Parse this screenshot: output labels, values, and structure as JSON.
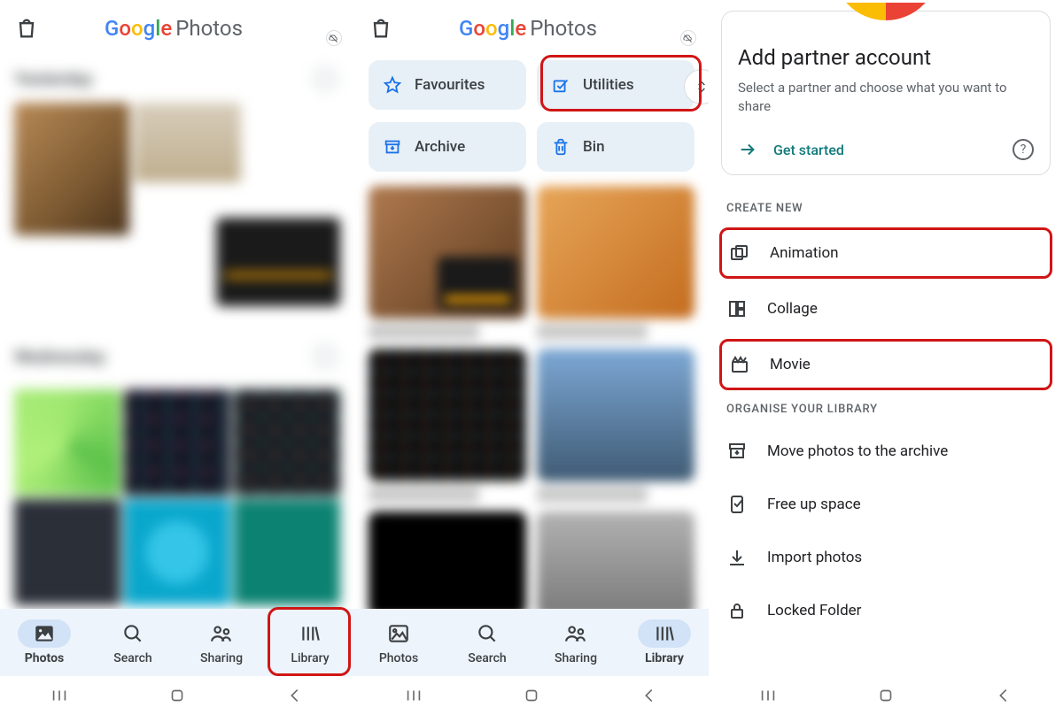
{
  "logo": {
    "word": "Google",
    "suffix": "Photos"
  },
  "panel1": {
    "dates": [
      "Yesterday",
      "Wednesday"
    ],
    "nav": {
      "items": [
        {
          "key": "photos",
          "label": "Photos",
          "active": true
        },
        {
          "key": "search",
          "label": "Search",
          "active": false
        },
        {
          "key": "sharing",
          "label": "Sharing",
          "active": false
        },
        {
          "key": "library",
          "label": "Library",
          "active": false
        }
      ]
    }
  },
  "panel2": {
    "chips": {
      "favourites": "Favourites",
      "utilities": "Utilities",
      "archive": "Archive",
      "bin": "Bin"
    },
    "nav": {
      "items": [
        {
          "key": "photos",
          "label": "Photos",
          "active": false
        },
        {
          "key": "search",
          "label": "Search",
          "active": false
        },
        {
          "key": "sharing",
          "label": "Sharing",
          "active": false
        },
        {
          "key": "library",
          "label": "Library",
          "active": true
        }
      ]
    }
  },
  "panel3": {
    "partner": {
      "title": "Add partner account",
      "subtitle": "Select a partner and choose what you want to share",
      "cta": "Get started"
    },
    "sections": {
      "create_new": "CREATE NEW",
      "organise": "ORGANISE YOUR LIBRARY"
    },
    "create": {
      "animation": "Animation",
      "collage": "Collage",
      "movie": "Movie"
    },
    "organise": {
      "archive_move": "Move photos to the archive",
      "free_space": "Free up space",
      "import": "Import photos",
      "locked": "Locked Folder"
    }
  }
}
